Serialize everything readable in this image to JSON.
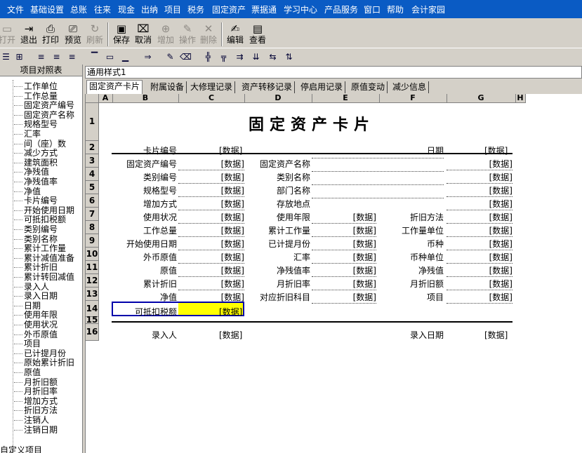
{
  "menu": [
    "文件",
    "基础设置",
    "总账",
    "往来",
    "现金",
    "出纳",
    "项目",
    "税务",
    "固定资产",
    "票据通",
    "学习中心",
    "产品服务",
    "窗口",
    "帮助",
    "会计家园"
  ],
  "toolbar1": [
    {
      "label": "打开",
      "icon": "open-icon",
      "disabled": true
    },
    {
      "label": "退出",
      "icon": "exit-icon",
      "disabled": false
    },
    {
      "label": "打印",
      "icon": "print-icon",
      "disabled": false
    },
    {
      "label": "预览",
      "icon": "preview-icon",
      "disabled": false
    },
    {
      "label": "刷新",
      "icon": "refresh-icon",
      "disabled": true
    },
    {
      "label": "保存",
      "icon": "save-icon",
      "disabled": false
    },
    {
      "label": "取消",
      "icon": "cancel-icon",
      "disabled": false
    },
    {
      "label": "增加",
      "icon": "add-icon",
      "disabled": true
    },
    {
      "label": "操作",
      "icon": "operate-icon",
      "disabled": true
    },
    {
      "label": "删除",
      "icon": "delete-icon",
      "disabled": true
    },
    {
      "label": "编辑",
      "icon": "edit-icon",
      "disabled": false
    },
    {
      "label": "查看",
      "icon": "view-icon",
      "disabled": false
    }
  ],
  "sidebar": {
    "title": "项目对照表",
    "items": [
      "工作单位",
      "工作总量",
      "固定资产编号",
      "固定资产名称",
      "规格型号",
      "汇率",
      "间（座）数",
      "减少方式",
      "建筑面积",
      "净残值",
      "净残值率",
      "净值",
      "卡片编号",
      "开始使用日期",
      "可抵扣税额",
      "类别编号",
      "类别名称",
      "累计工作量",
      "累计减值准备",
      "累计折旧",
      "累计转回减值",
      "录入人",
      "录入日期",
      "日期",
      "使用年限",
      "使用状况",
      "外币原值",
      "项目",
      "已计提月份",
      "原始累计折旧",
      "原值",
      "月折旧额",
      "月折旧率",
      "增加方式",
      "折旧方法",
      "注销人",
      "注销日期"
    ],
    "root": "自定义项目"
  },
  "style_name": "通用样式1",
  "tabs": [
    "固定资产卡片",
    "附属设备",
    "大修理记录",
    "资产转移记录",
    "停启用记录",
    "原值变动",
    "减少信息"
  ],
  "columns": [
    "A",
    "B",
    "C",
    "D",
    "E",
    "F",
    "G",
    "H"
  ],
  "rows": [
    "1",
    "2",
    "3",
    "4",
    "5",
    "6",
    "7",
    "8",
    "9",
    "10",
    "11",
    "12",
    "13",
    "14",
    "15",
    "16"
  ],
  "card": {
    "title": "固定资产卡片",
    "placeholder": "[数据]",
    "row2": {
      "left": "卡片编号",
      "right": "日期"
    },
    "row3": {
      "l1": "固定资产编号",
      "l2": "固定资产名称"
    },
    "row4": {
      "l1": "类别编号",
      "l2": "类别名称"
    },
    "row5": {
      "l1": "规格型号",
      "l2": "部门名称"
    },
    "row6": {
      "l1": "增加方式",
      "l2": "存放地点"
    },
    "row7": {
      "l1": "使用状况",
      "l2": "使用年限",
      "l3": "折旧方法"
    },
    "row8": {
      "l1": "工作总量",
      "l2": "累计工作量",
      "l3": "工作量单位"
    },
    "row9": {
      "l1": "开始使用日期",
      "l2": "已计提月份",
      "l3": "币种"
    },
    "row10": {
      "l1": "外币原值",
      "l2": "汇率",
      "l3": "币种单位"
    },
    "row11": {
      "l1": "原值",
      "l2": "净残值率",
      "l3": "净残值"
    },
    "row12": {
      "l1": "累计折旧",
      "l2": "月折旧率",
      "l3": "月折旧额"
    },
    "row13": {
      "l1": "净值",
      "l2": "对应折旧科目",
      "l3": "项目"
    },
    "row14": {
      "l1": "可抵扣税额"
    },
    "row16": {
      "left": "录入人",
      "right": "录入日期"
    }
  },
  "colors": {
    "menubar": "#0a5bc4",
    "selected_cell": "#ffff00",
    "selection_border": "#0000aa"
  }
}
